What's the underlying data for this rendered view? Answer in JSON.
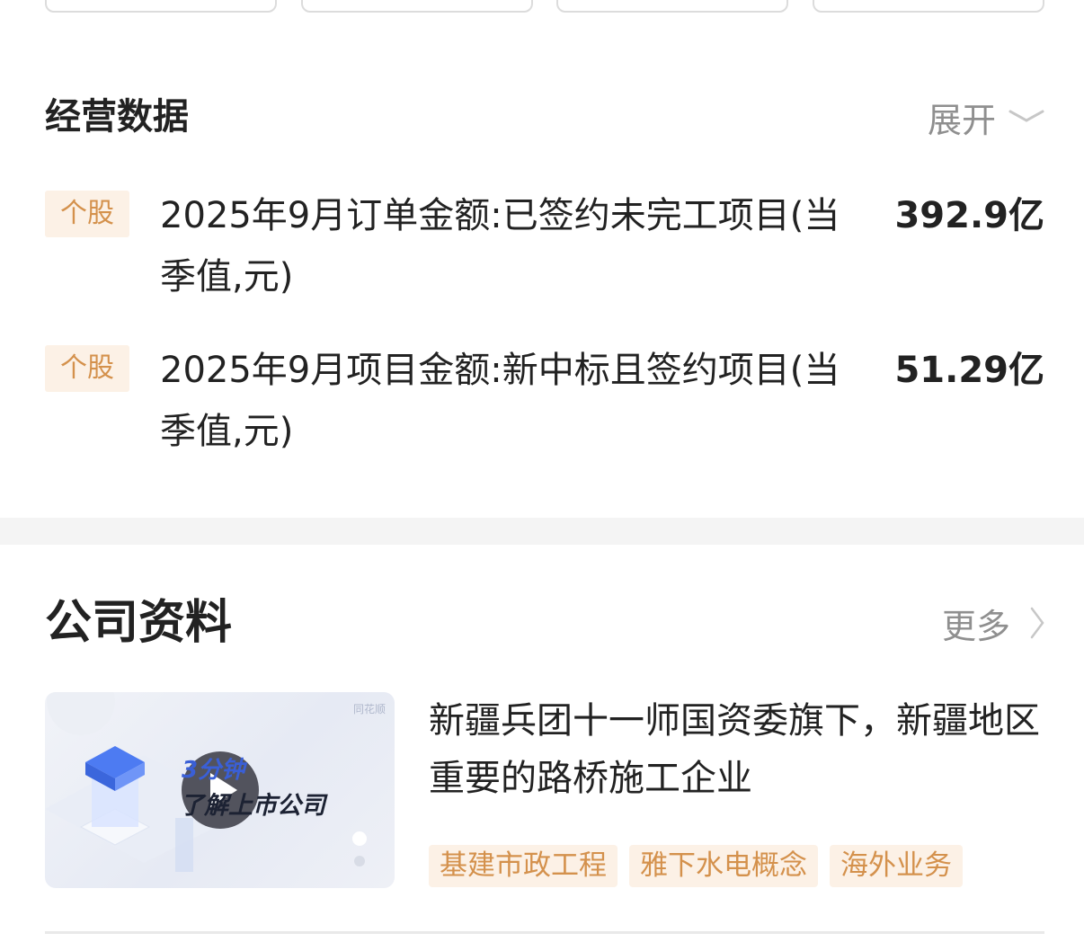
{
  "operations": {
    "title": "经营数据",
    "expand_label": "展开",
    "items": [
      {
        "badge": "个股",
        "label": "2025年9月订单金额:已签约未完工项目(当季值,元)",
        "value": "392.9亿"
      },
      {
        "badge": "个股",
        "label": "2025年9月项目金额:新中标且签约项目(当季值,元)",
        "value": "51.29亿"
      }
    ]
  },
  "company": {
    "title": "公司资料",
    "more_label": "更多",
    "video": {
      "line1": "3分钟",
      "line2": "了解上市公司",
      "logo": "同花顺"
    },
    "description": "新疆兵团十一师国资委旗下，新疆地区重要的路桥施工企业",
    "tags": [
      "基建市政工程",
      "雅下水电概念",
      "海外业务"
    ]
  },
  "colors": {
    "badge_bg": "#fcf1e6",
    "badge_text": "#d4914c",
    "muted_text": "#8f8f8f",
    "primary_text": "#222222"
  }
}
